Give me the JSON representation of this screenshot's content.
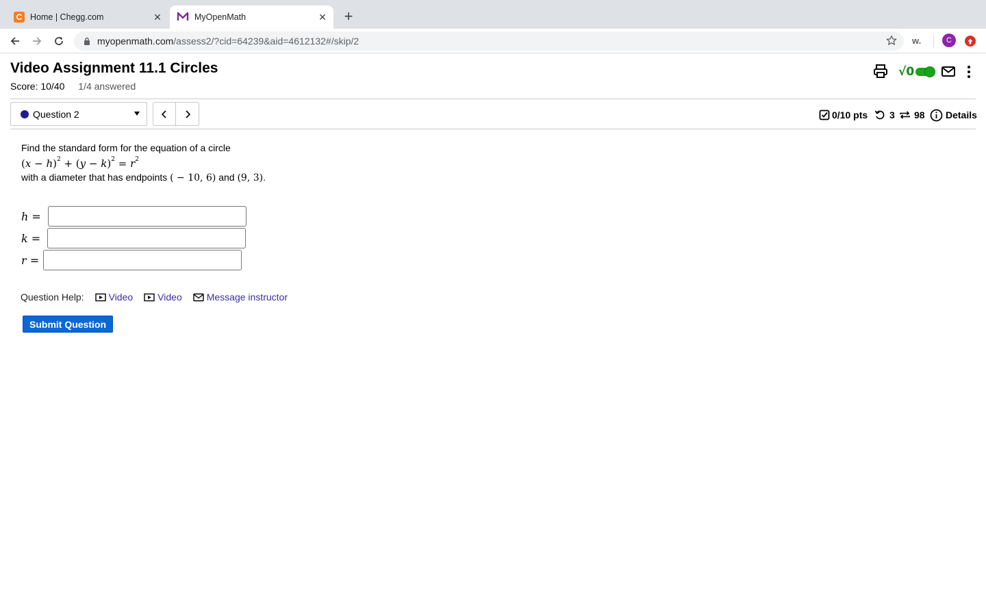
{
  "browser": {
    "tabs": [
      {
        "title": "Home | Chegg.com",
        "favicon": "chegg-c-icon",
        "active": false
      },
      {
        "title": "MyOpenMath",
        "favicon": "myopenmath-m-icon",
        "active": true
      }
    ],
    "favicon_letter": "C",
    "url_domain": "myopenmath.com",
    "url_path": "/assess2/?cid=64239&aid=4612132#/skip/2",
    "extension_label": "w.",
    "avatar_letter": "C"
  },
  "assignment": {
    "title": "Video Assignment 11.1 Circles",
    "score": "Score: 10/40",
    "answered": "1/4 answered"
  },
  "question_nav": {
    "selected": "Question 2",
    "points": "0/10 pts",
    "retries": "3",
    "regens": "98",
    "details_label": "Details"
  },
  "question": {
    "intro": "Find the standard form for the equation of a circle",
    "diameter_text": "with a diameter that has endpoints",
    "point1": "( − 10, 6)",
    "and_word": "and",
    "point2": "(9, 3)",
    "period": ".",
    "answers": [
      {
        "var": "h",
        "value": ""
      },
      {
        "var": "k",
        "value": ""
      },
      {
        "var": "r",
        "value": ""
      }
    ]
  },
  "help": {
    "label": "Question Help:",
    "links": [
      "Video",
      "Video",
      "Message instructor"
    ]
  },
  "submit_label": "Submit Question",
  "colors": {
    "accent": "#0b66d8",
    "link": "#3a2da3",
    "toggle_on": "#1aa51a",
    "question_dot": "#1c1c8c"
  }
}
